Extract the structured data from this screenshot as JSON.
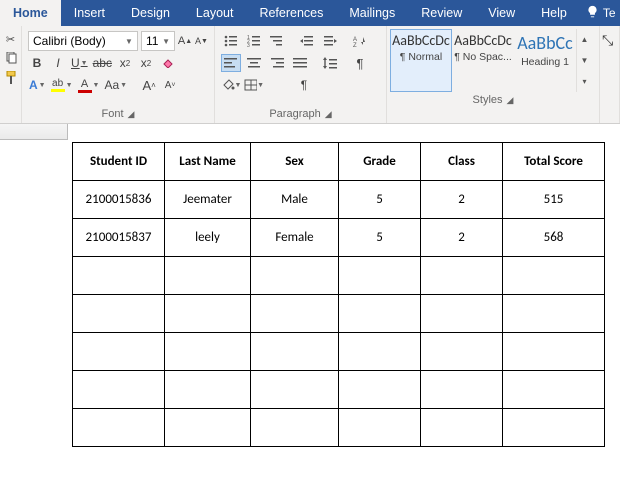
{
  "tabs": {
    "items": [
      "Home",
      "Insert",
      "Design",
      "Layout",
      "References",
      "Mailings",
      "Review",
      "View",
      "Help"
    ],
    "active": "Home",
    "tell_me": "Te"
  },
  "font": {
    "family": "Calibri (Body)",
    "size": "11",
    "group_label": "Font"
  },
  "paragraph": {
    "group_label": "Paragraph"
  },
  "styles": {
    "group_label": "Styles",
    "items": [
      {
        "preview": "AaBbCcDc",
        "name": "¶ Normal"
      },
      {
        "preview": "AaBbCcDc",
        "name": "¶ No Spac..."
      },
      {
        "preview": "AaBbCc",
        "name": "Heading 1"
      }
    ]
  },
  "table": {
    "headers": [
      "Student ID",
      "Last Name",
      "Sex",
      "Grade",
      "Class",
      "Total Score"
    ],
    "rows": [
      [
        "2100015836",
        "Jeemater",
        "Male",
        "5",
        "2",
        "515"
      ],
      [
        "2100015837",
        "leely",
        "Female",
        "5",
        "2",
        "568"
      ],
      [
        "",
        "",
        "",
        "",
        "",
        ""
      ],
      [
        "",
        "",
        "",
        "",
        "",
        ""
      ],
      [
        "",
        "",
        "",
        "",
        "",
        ""
      ],
      [
        "",
        "",
        "",
        "",
        "",
        ""
      ],
      [
        "",
        "",
        "",
        "",
        "",
        ""
      ]
    ]
  }
}
